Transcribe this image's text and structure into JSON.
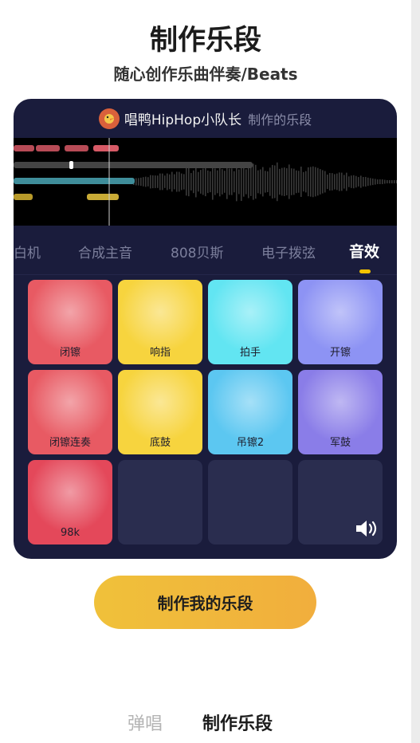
{
  "header": {
    "title": "制作乐段",
    "subtitle": "随心创作乐曲伴奏/Beats"
  },
  "card": {
    "user_name": "唱鸭HipHop小队长",
    "suffix": "制作的乐段",
    "tabs": [
      {
        "label": "白机",
        "active": false
      },
      {
        "label": "合成主音",
        "active": false
      },
      {
        "label": "808贝斯",
        "active": false
      },
      {
        "label": "电子拨弦",
        "active": false
      },
      {
        "label": "音效",
        "active": true
      }
    ],
    "pads": [
      {
        "label": "闭镲",
        "color": "#e85a63"
      },
      {
        "label": "响指",
        "color": "#f7d43e"
      },
      {
        "label": "拍手",
        "color": "#62e5f2"
      },
      {
        "label": "开镲",
        "color": "#8d93f4"
      },
      {
        "label": "闭镲连奏",
        "color": "#e85a63"
      },
      {
        "label": "底鼓",
        "color": "#f7d43e"
      },
      {
        "label": "吊镲2",
        "color": "#5cc7f1"
      },
      {
        "label": "军鼓",
        "color": "#8a7de8"
      },
      {
        "label": "98k",
        "color": "#e4485a"
      },
      {
        "label": "",
        "color": "#2a2d4f"
      },
      {
        "label": "",
        "color": "#2a2d4f"
      },
      {
        "label": "",
        "color": "#2a2d4f"
      }
    ]
  },
  "cta": {
    "label": "制作我的乐段"
  },
  "bottom_tabs": {
    "sing": "弹唱",
    "make": "制作乐段"
  },
  "colors": {
    "card_bg": "#1a1c3c",
    "accent": "#f5c400",
    "cta_start": "#f0c13a",
    "cta_end": "#f1ae3d"
  }
}
